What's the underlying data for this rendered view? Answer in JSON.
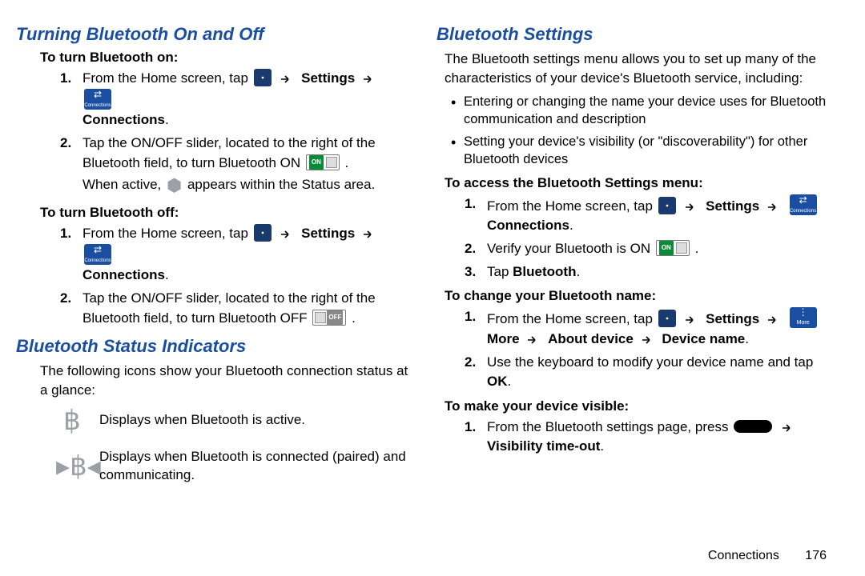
{
  "left": {
    "h1": "Turning Bluetooth On and Off",
    "onSub": "To turn Bluetooth on:",
    "on1_a": "From the Home screen, tap ",
    "settings": "Settings",
    "connections": "Connections",
    "period": ".",
    "on2": "Tap the ON/OFF slider, located to the right of the Bluetooth field, to turn Bluetooth ON ",
    "on2b": "When active, ",
    "on2c": " appears within the Status area.",
    "offSub": "To turn Bluetooth off:",
    "off2": "Tap the ON/OFF slider, located to the right of the Bluetooth field, to turn Bluetooth OFF ",
    "h2": "Bluetooth Status Indicators",
    "indIntro": "The following icons show your Bluetooth connection status at a glance:",
    "ind1": "Displays when Bluetooth is active.",
    "ind2": "Displays when Bluetooth is connected (paired) and communicating."
  },
  "right": {
    "h1": "Bluetooth Settings",
    "intro": "The Bluetooth settings menu allows you to set up many of the characteristics of your device's Bluetooth service, including:",
    "b1": "Entering or changing the name your device uses for Bluetooth communication and description",
    "b2": "Setting your device's visibility (or \"discoverability\") for other Bluetooth devices",
    "accessSub": "To access the Bluetooth Settings menu:",
    "acc2a": "Verify your Bluetooth is ON ",
    "acc3a": "Tap ",
    "bluetooth": "Bluetooth",
    "changeSub": "To change your Bluetooth name:",
    "more": "More",
    "about": "About device",
    "devname": "Device name",
    "chg2a": "Use the keyboard to modify your device name and tap ",
    "ok": "OK",
    "visibleSub": "To make your device visible:",
    "vis1a": "From the Bluetooth settings page, press ",
    "visTimeout": "Visibility time-out"
  },
  "footer": {
    "section": "Connections",
    "page": "176"
  },
  "iconLabels": {
    "connections": "Connections",
    "more": "More"
  }
}
